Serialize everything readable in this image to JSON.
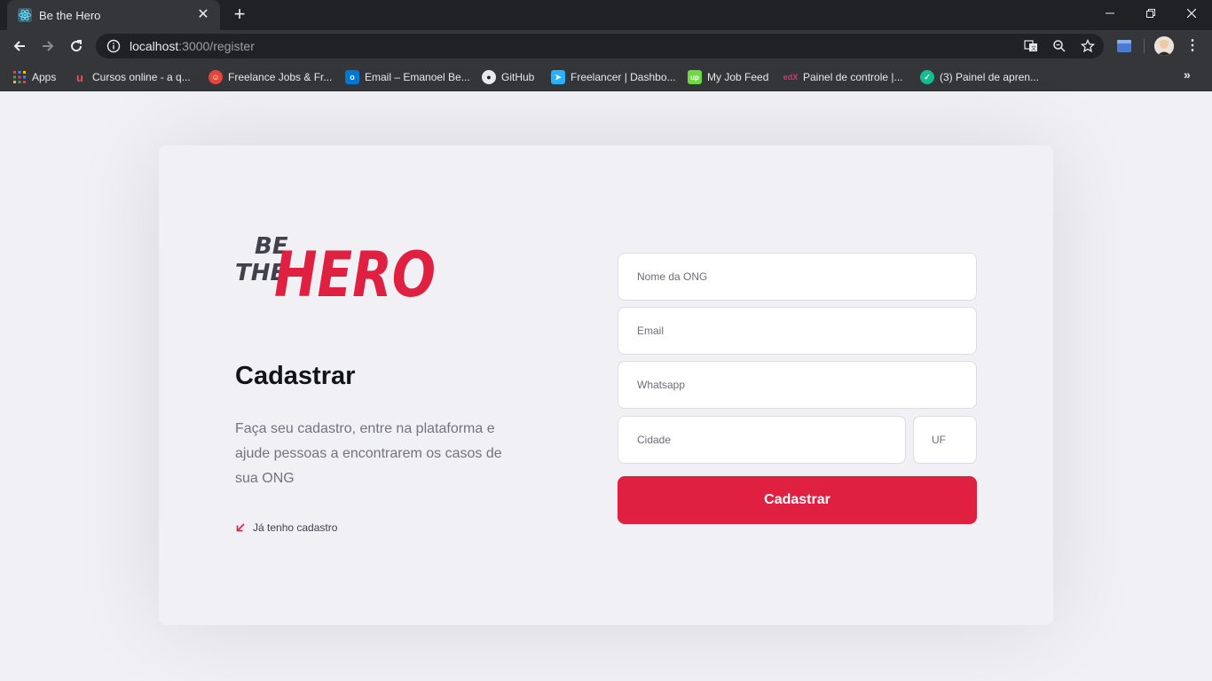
{
  "browser": {
    "tab_title": "Be the Hero",
    "url_host": "localhost",
    "url_path": ":3000/register",
    "bookmarks": [
      {
        "label": "Apps",
        "icon": "apps-grid-icon",
        "color": "#4285f4"
      },
      {
        "label": "Cursos online - a q...",
        "icon": "udemy-icon",
        "color": "#ec5252"
      },
      {
        "label": "Freelance Jobs & Fr...",
        "icon": "freelance-jobs-icon",
        "color": "#e8453c"
      },
      {
        "label": "Email – Emanoel Be...",
        "icon": "outlook-icon",
        "color": "#0078d4"
      },
      {
        "label": "GitHub",
        "icon": "github-icon",
        "color": "#e8eaed"
      },
      {
        "label": "Freelancer | Dashbo...",
        "icon": "freelancer-icon",
        "color": "#29b2fe"
      },
      {
        "label": "My Job Feed",
        "icon": "upwork-icon",
        "color": "#6fda44"
      },
      {
        "label": "Painel de controle |...",
        "icon": "edx-icon",
        "color": "#d23a6c"
      },
      {
        "label": "(3) Painel de apren...",
        "icon": "khan-academy-icon",
        "color": "#14bf96"
      }
    ]
  },
  "logo": {
    "line1": "BE",
    "line2": "THE",
    "line3": "HERO",
    "accent": "#e02041"
  },
  "register": {
    "title": "Cadastrar",
    "description": "Faça seu cadastro, entre na plataforma e ajude pessoas a encontrarem os casos de sua ONG",
    "back_link": "Já tenho cadastro",
    "fields": {
      "name_placeholder": "Nome da ONG",
      "email_placeholder": "Email",
      "whatsapp_placeholder": "Whatsapp",
      "city_placeholder": "Cidade",
      "uf_placeholder": "UF"
    },
    "submit_label": "Cadastrar",
    "accent_color": "#e02041"
  }
}
